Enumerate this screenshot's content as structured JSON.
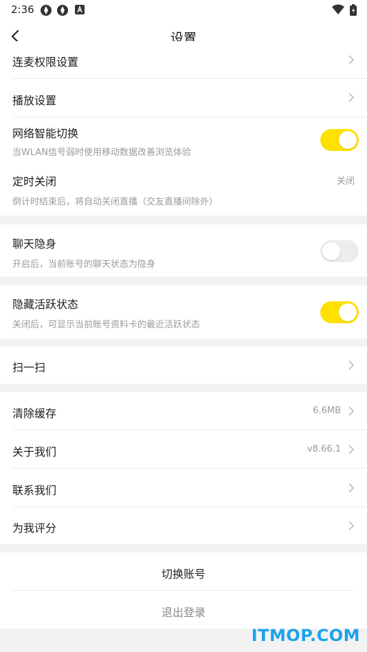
{
  "status_bar": {
    "time": "2:36"
  },
  "header": {
    "title": "设置"
  },
  "rows": {
    "mic_permission": {
      "title": "连麦权限设置"
    },
    "playback": {
      "title": "播放设置"
    },
    "network_switch": {
      "title": "网络智能切换",
      "subtitle": "当WLAN信号弱时使用移动数据改善浏览体验",
      "enabled": true
    },
    "timer_off": {
      "title": "定时关闭",
      "value": "关闭",
      "subtitle": "倒计时结束后，将自动关闭直播（交友直播间除外）"
    },
    "chat_invisible": {
      "title": "聊天隐身",
      "subtitle": "开启后，当前账号的聊天状态为隐身",
      "enabled": false
    },
    "hide_active": {
      "title": "隐藏活跃状态",
      "subtitle": "关闭后，可显示当前账号资料卡的最近活跃状态",
      "enabled": true
    },
    "scan": {
      "title": "扫一扫"
    },
    "clear_cache": {
      "title": "清除缓存",
      "value": "6.6MB"
    },
    "about": {
      "title": "关于我们",
      "value": "v8.66.1"
    },
    "contact": {
      "title": "联系我们"
    },
    "rate": {
      "title": "为我评分"
    }
  },
  "actions": {
    "switch_account": "切换账号",
    "logout": "退出登录"
  },
  "watermark": "ITMOP.COM",
  "colors": {
    "accent": "#ffe100",
    "watermark": "#1aa3ee"
  }
}
